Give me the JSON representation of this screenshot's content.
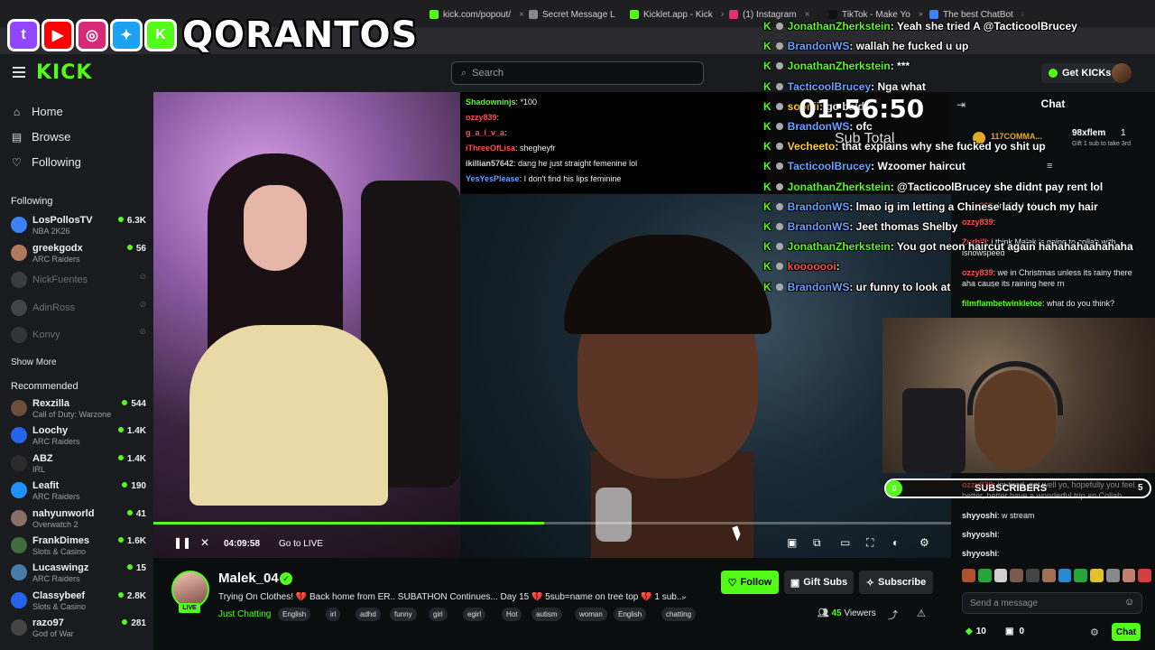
{
  "browser": {
    "tabs": [
      {
        "label": "kick.com/popout/",
        "color": "#53fc18"
      },
      {
        "label": "Secret Message L",
        "color": "#888888"
      },
      {
        "label": "Kicklet.app - Kick",
        "color": "#53fc18"
      },
      {
        "label": "(1) Instagram",
        "color": "#e1306c"
      },
      {
        "label": "TikTok - Make Yo",
        "color": "#111111"
      },
      {
        "label": "The best ChatBot",
        "color": "#3b82f6"
      }
    ]
  },
  "overlay": {
    "streamer_name": "QORANTOS",
    "socials": [
      {
        "icon": "twitch-icon",
        "glyph": "t",
        "color": "#9146ff"
      },
      {
        "icon": "youtube-icon",
        "glyph": "▶",
        "color": "#ff0000"
      },
      {
        "icon": "instagram-icon",
        "glyph": "◎",
        "color": "#d62976"
      },
      {
        "icon": "twitter-icon",
        "glyph": "✦",
        "color": "#1da1f2"
      },
      {
        "icon": "kick-icon",
        "glyph": "K",
        "color": "#53fc18"
      }
    ],
    "timer": "01:56:50",
    "sub_total": "Sub Total",
    "sub_goal": {
      "label": "SUBSCRIBERS",
      "current": "0",
      "goal": "5",
      "progress": 0
    }
  },
  "header": {
    "logo": "KICK",
    "search_placeholder": "Search",
    "get_kicks": "Get KICKs"
  },
  "sidebar": {
    "nav": [
      {
        "label": "Home",
        "icon": "⌂"
      },
      {
        "label": "Browse",
        "icon": "▤"
      },
      {
        "label": "Following",
        "icon": "♡"
      }
    ],
    "following_title": "Following",
    "following": [
      {
        "name": "LosPollosTV",
        "category": "NBA 2K26",
        "viewers": "6.3K",
        "color": "#3b82f6"
      },
      {
        "name": "greekgodx",
        "category": "ARC Raiders",
        "viewers": "56",
        "color": "#b07a5a"
      },
      {
        "name": "NickFuentes",
        "offline": true,
        "color": "#666"
      },
      {
        "name": "AdinRoss",
        "offline": true,
        "color": "#777"
      },
      {
        "name": "Konvy",
        "offline": true,
        "color": "#555"
      }
    ],
    "show_more": "Show More",
    "recommended_title": "Recommended",
    "recommended": [
      {
        "name": "Rexzilla",
        "category": "Call of Duty: Warzone",
        "viewers": "544",
        "color": "#6b4e3c"
      },
      {
        "name": "Loochy",
        "category": "ARC Raiders",
        "viewers": "1.4K",
        "color": "#2563eb"
      },
      {
        "name": "ABZ",
        "category": "IRL",
        "viewers": "1.4K",
        "color": "#2b2b2b"
      },
      {
        "name": "Leafit",
        "category": "ARC Raiders",
        "viewers": "190",
        "color": "#1e90ff"
      },
      {
        "name": "nahyunworld",
        "category": "Overwatch 2",
        "viewers": "41",
        "color": "#8a6f66"
      },
      {
        "name": "FrankDimes",
        "category": "Slots & Casino",
        "viewers": "1.6K",
        "color": "#3f6b3f"
      },
      {
        "name": "Lucaswingz",
        "category": "ARC Raiders",
        "viewers": "15",
        "color": "#4a7aa8"
      },
      {
        "name": "Classybeef",
        "category": "Slots & Casino",
        "viewers": "2.8K",
        "color": "#2563eb"
      },
      {
        "name": "razo97",
        "category": "God of War",
        "viewers": "281",
        "color": "#444"
      }
    ]
  },
  "video_overlay_chat": [
    {
      "user": "Shadowninjs",
      "msg": ": *100",
      "color": "#53fc18"
    },
    {
      "user": "ozzy839",
      "msg": ": ",
      "color": "#ff4d4d"
    },
    {
      "user": "g_a_l_v_a",
      "msg": ": ",
      "color": "#ff4d4d"
    },
    {
      "user": "iThreeOfLisa",
      "msg": ": shegheyfr",
      "color": "#ff4d4d"
    },
    {
      "user": "ikillian57642",
      "msg": ": dang he just straight femenine lol",
      "color": "#cfcfcf"
    },
    {
      "user": "YesYesPlease",
      "msg": ": I don't find his lips feminine",
      "color": "#6aa0ff"
    }
  ],
  "big_chat": [
    {
      "user": "JonathanZherkstein",
      "msg": ": Yeah she tried A @TacticoolBrucey",
      "ucolor": "#53fc18",
      "badge": "k"
    },
    {
      "user": "BrandonWS",
      "msg": ": wallah he fucked u up",
      "ucolor": "#6aa0ff",
      "badge": "k"
    },
    {
      "user": "JonathanZherkstein",
      "msg": ": ***",
      "ucolor": "#53fc18",
      "badge": "k"
    },
    {
      "user": "TacticoolBrucey",
      "msg": ": Nga what",
      "ucolor": "#6aa0ff",
      "badge": "k"
    },
    {
      "user": "soonii",
      "msg": ": go bald",
      "ucolor": "#ffcc33",
      "badge": "k"
    },
    {
      "user": "BrandonWS",
      "msg": ": ofc",
      "ucolor": "#6aa0ff",
      "badge": "k"
    },
    {
      "user": "Vecheeto",
      "msg": ": that explains why she fucked yo shit up",
      "ucolor": "#ffcc33",
      "badge": "k"
    },
    {
      "user": "TacticoolBrucey",
      "msg": ": Wzoomer haircut",
      "ucolor": "#6aa0ff",
      "badge": "k"
    },
    {
      "user": "JonathanZherkstein",
      "msg": ": @TacticoolBrucey she didnt pay rent lol",
      "ucolor": "#53fc18",
      "badge": "k"
    },
    {
      "user": "BrandonWS",
      "msg": ": lmao ig im letting a Chinese lady touch my hair",
      "ucolor": "#6aa0ff",
      "badge": "k"
    },
    {
      "user": "BrandonWS",
      "msg": ": Jeet thomas Shelby",
      "ucolor": "#6aa0ff",
      "badge": "k"
    },
    {
      "user": "JonathanZherkstein",
      "msg": ": You got neon haircut again hahahahaahahaha",
      "ucolor": "#53fc18",
      "badge": "k"
    },
    {
      "user": "kooooooi",
      "msg": ": ",
      "ucolor": "#ff4d4d",
      "badge": "k"
    },
    {
      "user": "BrandonWS",
      "msg": ": ur funny to look at",
      "ucolor": "#6aa0ff",
      "badge": "k"
    }
  ],
  "chat": {
    "title": "Chat",
    "pinned_left": "117COMMA...",
    "pinned_right": "98xflem",
    "pinned_count": "1",
    "pinned_sub": "Gift 1 sub to take 3rd",
    "messages": [
      {
        "user": "ozzy839",
        "msg": ": im fired lol",
        "color": "#ff4d4d"
      },
      {
        "user": "ozzy839",
        "msg": ": ",
        "color": "#ff4d4d"
      },
      {
        "user": "Zurbill",
        "msg": ": i think Malek is going to collab with ishowspeed",
        "color": "#ff4d4d"
      },
      {
        "user": "ozzy839",
        "msg": ": we in Christmas unless its rainy there aha cause its raining here rn",
        "color": "#ff4d4d"
      },
      {
        "user": "filmflambetwinkletoe",
        "msg": ": what do you think?",
        "color": "#53fc18"
      }
    ],
    "lower_messages": [
      {
        "user": "ozzy839",
        "msg": ": im tired, get well yo, hopefully you feel better, better have a wonderful trip an Collab",
        "color": "#ff4d4d"
      },
      {
        "user": "shyyoshi",
        "msg": ": w stream",
        "color": "#e8e8e8"
      },
      {
        "user": "shyyoshi",
        "msg": ": ",
        "color": "#e8e8e8"
      },
      {
        "user": "shyyoshi",
        "msg": ": ",
        "color": "#e8e8e8"
      }
    ],
    "input_placeholder": "Send a message",
    "points": "10",
    "gift_count": "0",
    "send": "Chat"
  },
  "player": {
    "time": "04:09:58",
    "go_live": "Go to LIVE",
    "progress": 0.49
  },
  "stream": {
    "channel": "Malek_04",
    "title": "Trying On Clothes! 💔 Back home from ER.. SUBATHON Continues... Day 15 💔 5sub=name on tree top 💔 1 sub...",
    "category": "Just Chatting",
    "tags": [
      "English",
      "irl",
      "adhd",
      "funny",
      "girl",
      "egirl",
      "Hot",
      "autism",
      "woman",
      "English",
      "chatting"
    ],
    "follow": "Follow",
    "gift_subs": "Gift Subs",
    "subscribe": "Subscribe",
    "viewers": "45",
    "viewers_label": "Viewers",
    "live": "LIVE"
  }
}
